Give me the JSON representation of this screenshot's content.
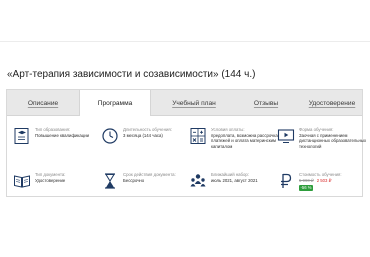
{
  "page": {
    "title": "«Арт-терапия зависимости и созависимости» (144 ч.)"
  },
  "tabs": [
    {
      "label": "Описание",
      "active": false
    },
    {
      "label": "Программа",
      "active": true
    },
    {
      "label": "Учебный план",
      "active": false
    },
    {
      "label": "Отзывы",
      "active": false
    },
    {
      "label": "Удостоверение",
      "active": false
    }
  ],
  "info": {
    "education_type": {
      "label": "Тип образования:",
      "value": "Повышение квалификации",
      "icon": "graduation-cap-icon"
    },
    "duration": {
      "label": "Длительность обучения:",
      "value": "3 месяца (144 часа)",
      "icon": "clock-icon"
    },
    "payment": {
      "label": "Условия оплаты:",
      "value": "предоплата, возможна рассрочка платежей и оплата материнским капиталом",
      "icon": "calculator-icon"
    },
    "study_form": {
      "label": "Форма обучения:",
      "value": "Заочная с применением дистанционных образовательных технологий",
      "icon": "monitor-play-icon"
    },
    "document_type": {
      "label": "Тип документа:",
      "value": "Удостоверение",
      "icon": "open-book-icon"
    },
    "validity": {
      "label": "Срок действия документа:",
      "value": "Бессрочно",
      "icon": "hourglass-icon"
    },
    "enrollment": {
      "label": "Ближайший набор:",
      "value": "июль 2021, август 2021",
      "icon": "people-icon"
    },
    "cost": {
      "label": "Стоимость обучения:",
      "old_price": "5 990 ₽",
      "new_price": "2 503 ₽",
      "discount": "-56 %",
      "icon": "ruble-icon"
    }
  },
  "colors": {
    "accent_icon": "#1f3a63",
    "discount_badge": "#2e9d3c",
    "new_price": "#d92c2c",
    "tab_bar": "#e8e8e8"
  }
}
